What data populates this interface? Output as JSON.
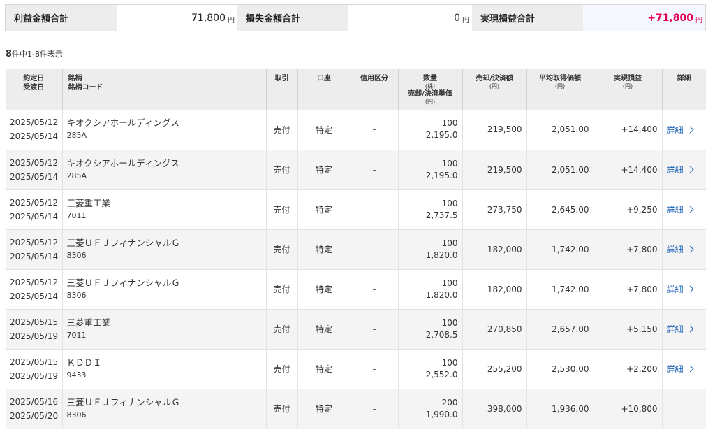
{
  "summary": {
    "profit_label": "利益金額合計",
    "profit_value": "71,800",
    "loss_label": "損失金額合計",
    "loss_value": "0",
    "realized_label": "実現損益合計",
    "realized_value": "+71,800",
    "unit": "円"
  },
  "count": {
    "total": "8",
    "text": "件中1-8件表示"
  },
  "headers": {
    "date1": "約定日",
    "date2": "受渡日",
    "stock1": "銘柄",
    "stock2": "銘柄コード",
    "trade": "取引",
    "account": "口座",
    "credit": "信用区分",
    "qty": "数量",
    "qty_unit": "(株)",
    "unit_price": "売却/決済単価",
    "unit_price_unit": "(円)",
    "amount": "売却/決済額",
    "amount_unit": "(円)",
    "avg": "平均取得価額",
    "avg_unit": "(円)",
    "pl": "実現損益",
    "pl_unit": "(円)",
    "detail": "詳細"
  },
  "rows": [
    {
      "trade_date": "2025/05/12",
      "settle_date": "2025/05/14",
      "name": "キオクシアホールディングス",
      "code": "285A",
      "type": "売付",
      "account": "特定",
      "credit": "-",
      "qty": "100",
      "price": "2,195.0",
      "amount": "219,500",
      "avg": "2,051.00",
      "pl": "+14,400",
      "detail": "詳細"
    },
    {
      "trade_date": "2025/05/12",
      "settle_date": "2025/05/14",
      "name": "キオクシアホールディングス",
      "code": "285A",
      "type": "売付",
      "account": "特定",
      "credit": "-",
      "qty": "100",
      "price": "2,195.0",
      "amount": "219,500",
      "avg": "2,051.00",
      "pl": "+14,400",
      "detail": "詳細"
    },
    {
      "trade_date": "2025/05/12",
      "settle_date": "2025/05/14",
      "name": "三菱重工業",
      "code": "7011",
      "type": "売付",
      "account": "特定",
      "credit": "-",
      "qty": "100",
      "price": "2,737.5",
      "amount": "273,750",
      "avg": "2,645.00",
      "pl": "+9,250",
      "detail": "詳細"
    },
    {
      "trade_date": "2025/05/12",
      "settle_date": "2025/05/14",
      "name": "三菱ＵＦＪフィナンシャルＧ",
      "code": "8306",
      "type": "売付",
      "account": "特定",
      "credit": "-",
      "qty": "100",
      "price": "1,820.0",
      "amount": "182,000",
      "avg": "1,742.00",
      "pl": "+7,800",
      "detail": "詳細"
    },
    {
      "trade_date": "2025/05/12",
      "settle_date": "2025/05/14",
      "name": "三菱ＵＦＪフィナンシャルＧ",
      "code": "8306",
      "type": "売付",
      "account": "特定",
      "credit": "-",
      "qty": "100",
      "price": "1,820.0",
      "amount": "182,000",
      "avg": "1,742.00",
      "pl": "+7,800",
      "detail": "詳細"
    },
    {
      "trade_date": "2025/05/15",
      "settle_date": "2025/05/19",
      "name": "三菱重工業",
      "code": "7011",
      "type": "売付",
      "account": "特定",
      "credit": "-",
      "qty": "100",
      "price": "2,708.5",
      "amount": "270,850",
      "avg": "2,657.00",
      "pl": "+5,150",
      "detail": "詳細"
    },
    {
      "trade_date": "2025/05/15",
      "settle_date": "2025/05/19",
      "name": "ＫＤＤＩ",
      "code": "9433",
      "type": "売付",
      "account": "特定",
      "credit": "-",
      "qty": "100",
      "price": "2,552.0",
      "amount": "255,200",
      "avg": "2,530.00",
      "pl": "+2,200",
      "detail": "詳細"
    },
    {
      "trade_date": "2025/05/16",
      "settle_date": "2025/05/20",
      "name": "三菱ＵＦＪフィナンシャルＧ",
      "code": "8306",
      "type": "売付",
      "account": "特定",
      "credit": "-",
      "qty": "200",
      "price": "1,990.0",
      "amount": "398,000",
      "avg": "1,936.00",
      "pl": "+10,800",
      "detail": ""
    }
  ]
}
